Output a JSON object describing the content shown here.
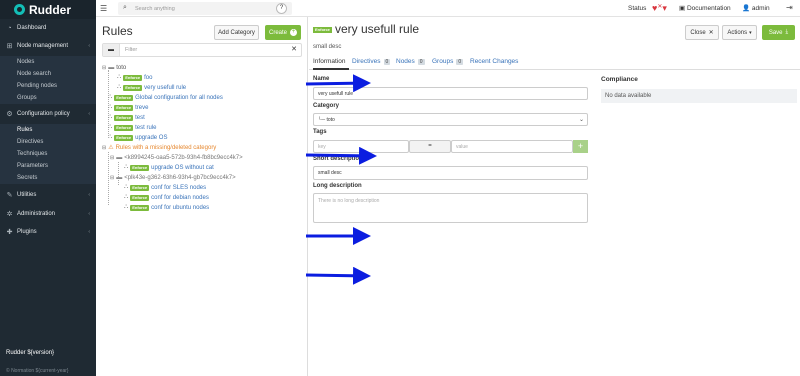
{
  "app": {
    "brand": "Rudder",
    "version": "Rudder ${version}",
    "copyright": "© Normation ${current-year}"
  },
  "sidebar": {
    "items": [
      {
        "label": "Dashboard",
        "icon": "dashboard-icon"
      },
      {
        "label": "Node management",
        "icon": "sitemap-icon",
        "caret": "‹"
      },
      {
        "label": "Nodes",
        "sub": true
      },
      {
        "label": "Node search",
        "sub": true
      },
      {
        "label": "Pending nodes",
        "sub": true
      },
      {
        "label": "Groups",
        "sub": true
      },
      {
        "label": "Configuration policy",
        "icon": "gears-icon",
        "caret": "‹"
      },
      {
        "label": "Rules",
        "sub": true
      },
      {
        "label": "Directives",
        "sub": true
      },
      {
        "label": "Techniques",
        "sub": true
      },
      {
        "label": "Parameters",
        "sub": true
      },
      {
        "label": "Secrets",
        "sub": true
      },
      {
        "label": "Utilities",
        "icon": "wrench-icon",
        "caret": "‹"
      },
      {
        "label": "Administration",
        "icon": "gear-icon",
        "caret": "‹"
      },
      {
        "label": "Plugins",
        "icon": "puzzle-icon",
        "caret": "‹"
      }
    ]
  },
  "topbar": {
    "search_placeholder": "Search anything",
    "status_label": "Status",
    "documentation_label": "Documentation",
    "user_label": "admin"
  },
  "rules_panel": {
    "title": "Rules",
    "add_category_label": "Add Category",
    "create_label": "Create",
    "filter_placeholder": "Filter",
    "tree": [
      {
        "kind": "category",
        "label": "toto"
      },
      {
        "kind": "rule",
        "badge": "Enforce",
        "label": "foo"
      },
      {
        "kind": "rule",
        "badge": "Enforce",
        "label": "very usefull rule"
      },
      {
        "kind": "rule",
        "badge": "Enforce",
        "label": "Global configuration for all nodes"
      },
      {
        "kind": "rule",
        "badge": "Enforce",
        "label": "treve"
      },
      {
        "kind": "rule",
        "badge": "Enforce",
        "label": "test"
      },
      {
        "kind": "rule",
        "badge": "Enforce",
        "label": "test rule"
      },
      {
        "kind": "rule",
        "badge": "Enforce",
        "label": "upgrade OS"
      },
      {
        "kind": "warning",
        "label": "Rules with a missing/deleted category"
      },
      {
        "kind": "subcat",
        "label": "<k8994245-oaa5-572b-93h4-fb8bc9ecc4k7>"
      },
      {
        "kind": "rule",
        "badge": "Enforce",
        "label": "upgrade OS without cat"
      },
      {
        "kind": "subcat",
        "label": "<plk43e-g362-63h6-93h4-gb7bc9ecc4k7>"
      },
      {
        "kind": "rule",
        "badge": "Enforce",
        "label": "conf for SLES nodes"
      },
      {
        "kind": "rule",
        "badge": "Enforce",
        "label": "conf for debian nodes"
      },
      {
        "kind": "rule",
        "badge": "Enforce",
        "label": "conf for ubuntu nodes"
      }
    ]
  },
  "rule_detail": {
    "badge": "Enforce",
    "title": "very usefull rule",
    "short_desc": "small desc",
    "close_label": "Close",
    "actions_label": "Actions",
    "save_label": "Save",
    "tabs": [
      {
        "label": "Information",
        "count": ""
      },
      {
        "label": "Directives",
        "count": "0"
      },
      {
        "label": "Nodes",
        "count": "0"
      },
      {
        "label": "Groups",
        "count": "0"
      },
      {
        "label": "Recent Changes",
        "count": ""
      }
    ],
    "name_label": "Name",
    "name_value": "very usefull rule",
    "category_label": "Category",
    "category_value": "└─ toto",
    "tags_label": "Tags",
    "tag_key_placeholder": "key",
    "tag_eq": "=",
    "tag_value_placeholder": "value",
    "short_desc_label": "Short description",
    "short_desc_value": "small desc",
    "long_desc_label": "Long description",
    "long_desc_placeholder": "There is no long description",
    "compliance_label": "Compliance",
    "compliance_value": "No data available"
  },
  "colors": {
    "sidebar_bg": "#1f2a33",
    "accent_green": "#7cbb3c",
    "link_blue": "#3973b9",
    "arrow_blue": "#0b1de0",
    "warning": "#e6872e"
  }
}
